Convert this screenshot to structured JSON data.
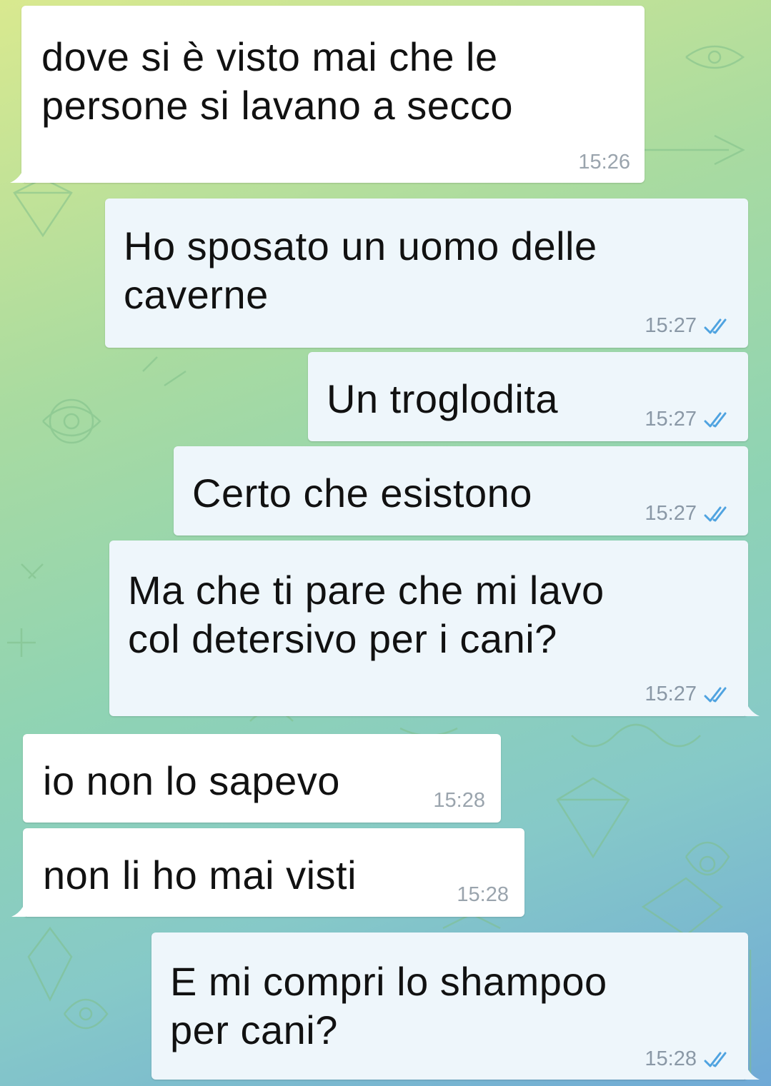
{
  "conversation": {
    "messages": [
      {
        "dir": "in",
        "text": "dove si è visto mai che le\npersone si lavano a secco",
        "time": "15:26"
      },
      {
        "dir": "out",
        "text": "Ho sposato un uomo delle\ncaverne",
        "time": "15:27",
        "status": "read-double-check-icon"
      },
      {
        "dir": "out",
        "text": "Un troglodita",
        "time": "15:27",
        "status": "read-double-check-icon"
      },
      {
        "dir": "out",
        "text": "Certo che esistono",
        "time": "15:27",
        "status": "read-double-check-icon"
      },
      {
        "dir": "out",
        "text": "Ma che ti pare che mi lavo\ncol detersivo per i cani?",
        "time": "15:27",
        "status": "read-double-check-icon"
      },
      {
        "dir": "in",
        "text": "io non lo sapevo",
        "time": "15:28"
      },
      {
        "dir": "in",
        "text": "non li ho mai visti",
        "time": "15:28"
      },
      {
        "dir": "out",
        "text": "E mi compri lo shampoo\nper cani?",
        "time": "15:28",
        "status": "read-double-check-icon"
      }
    ]
  },
  "colors": {
    "incoming_bubble": "#ffffff",
    "outgoing_bubble": "#eef6fb",
    "check_color": "#4fa3e0"
  }
}
